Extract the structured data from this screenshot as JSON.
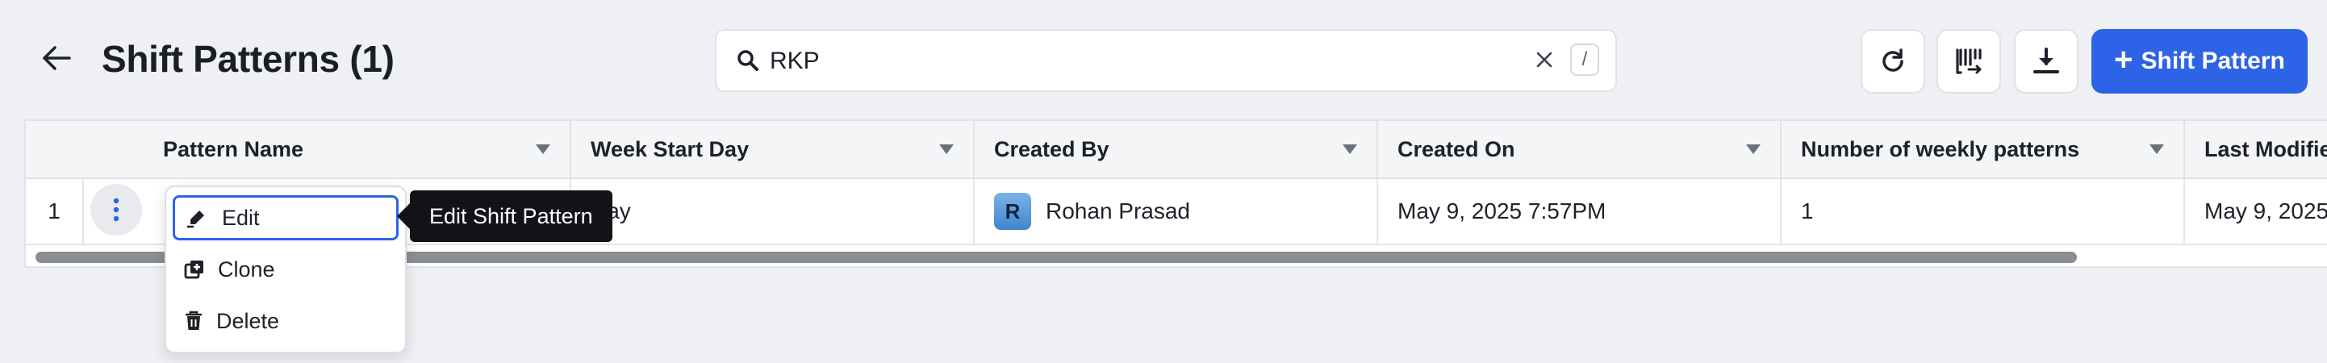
{
  "header": {
    "title": "Shift Patterns (1)",
    "add_button_label": "Shift Pattern"
  },
  "search": {
    "value": "RKP",
    "shortcut": "/"
  },
  "grid": {
    "columns": [
      "Pattern Name",
      "Week Start Day",
      "Created By",
      "Created On",
      "Number of weekly patterns",
      "Last Modified"
    ],
    "rows": [
      {
        "index": "1",
        "pattern_name": "",
        "week_start_day": "Day",
        "created_by": "Rohan Prasad",
        "created_by_initial": "R",
        "created_on": "May 9, 2025 7:57PM",
        "weekly_patterns": "1",
        "last_modified": "May 9, 2025"
      }
    ]
  },
  "context_menu": {
    "items": [
      "Edit",
      "Clone",
      "Delete"
    ],
    "tooltip": "Edit Shift Pattern"
  },
  "colors": {
    "accent": "#2d63e6",
    "background": "#eef0f3",
    "tooltip_bg": "#111317"
  },
  "icons": [
    "back-arrow-icon",
    "search-icon",
    "close-icon",
    "refresh-icon",
    "columns-icon",
    "download-icon",
    "plus-icon",
    "kebab-icon",
    "pencil-icon",
    "clone-icon",
    "trash-icon",
    "sort-arrow-icon"
  ]
}
